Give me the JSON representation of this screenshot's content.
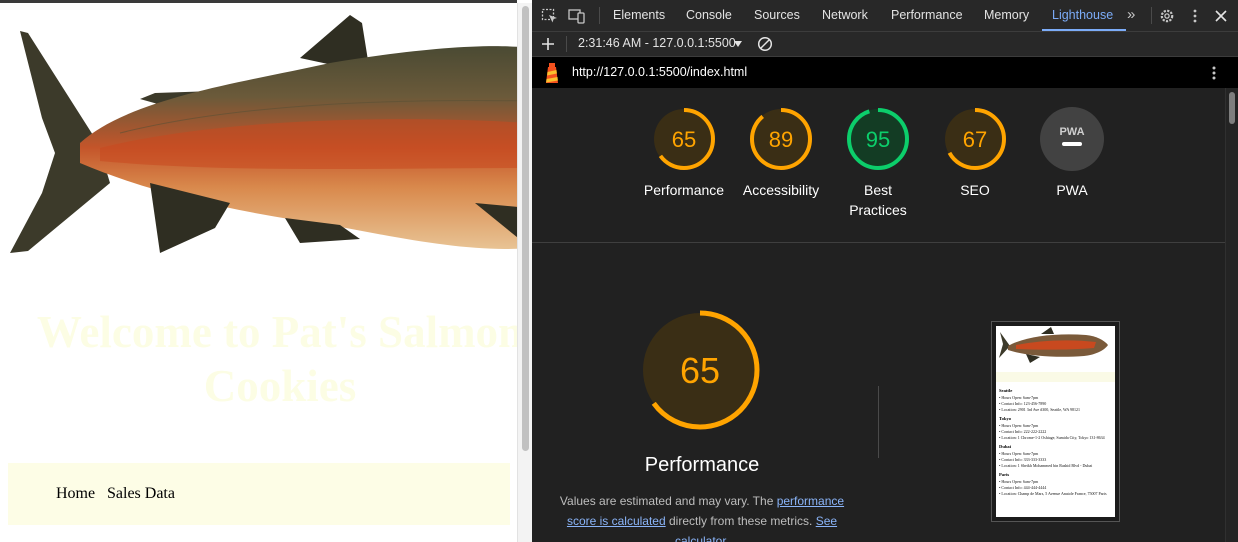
{
  "page": {
    "heading": "Welcome to Pat's Salmon Cookies",
    "nav": [
      "Home",
      "Sales Data"
    ]
  },
  "devtools": {
    "tabs": [
      "Elements",
      "Console",
      "Sources",
      "Network",
      "Performance",
      "Memory",
      "Lighthouse"
    ],
    "active_tab": "Lighthouse",
    "report_selector": "2:31:46 AM - 127.0.0.1:5500",
    "report_url": "http://127.0.0.1:5500/index.html",
    "scores": [
      {
        "label": "Performance",
        "value": "65",
        "status": "average"
      },
      {
        "label": "Accessibility",
        "value": "89",
        "status": "average"
      },
      {
        "label": "Best Practices",
        "value": "95",
        "status": "pass"
      },
      {
        "label": "SEO",
        "value": "67",
        "status": "average"
      },
      {
        "label": "PWA",
        "value": "PWA",
        "status": "na"
      }
    ],
    "featured": {
      "value": "65",
      "title": "Performance",
      "note_prefix": "Values are estimated and may vary. The ",
      "link1": "performance score is calculated",
      "note_middle": " directly from these metrics. ",
      "link2": "See calculator."
    },
    "screenshot": {
      "cities": [
        {
          "name": "Seattle",
          "items": [
            "Hours Open: 6am-7pm",
            "Contact Info: 123-456-7890",
            "Location: 2901 3rd Ave #300, Seattle, WA 98121"
          ]
        },
        {
          "name": "Tokyo",
          "items": [
            "Hours Open: 6am-7pm",
            "Contact Info: 222-222-2222",
            "Location: 1 Chrome-1-2 Oshiage, Sumida City, Tokyo 131-8634"
          ]
        },
        {
          "name": "Dubai",
          "items": [
            "Hours Open: 6am-7pm",
            "Contact Info: 333-333-3333",
            "Location: 1 Sheikh Mohammed bin Rashid Blvd - Dubai"
          ]
        },
        {
          "name": "Paris",
          "items": [
            "Hours Open: 6am-7pm",
            "Contact Info: 444-444-4444",
            "Location: Champ de Mars, 5 Avenue Anatole France, 75007 Paris"
          ]
        }
      ]
    }
  },
  "colors": {
    "average": "#ffa400",
    "pass": "#0cce6b",
    "fail": "#ff4e42",
    "link": "#8ab4f8",
    "active_tab": "#7cacf8"
  }
}
